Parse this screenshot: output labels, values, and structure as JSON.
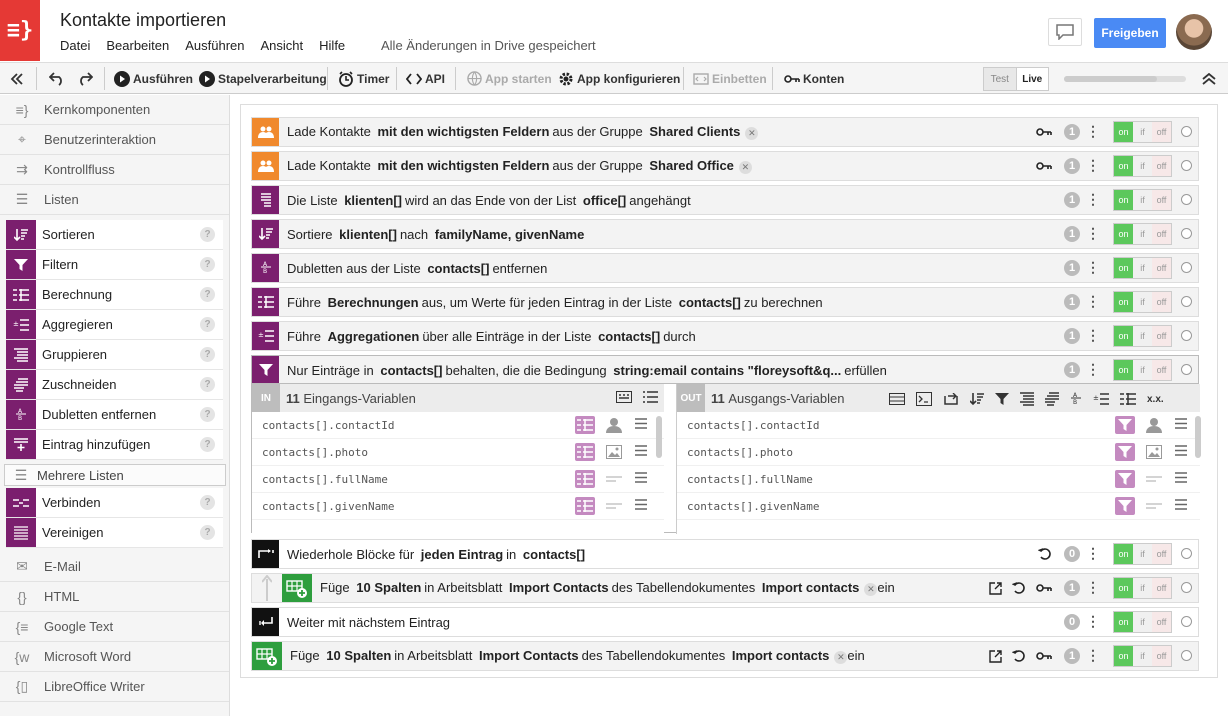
{
  "app": {
    "logo": "≡}",
    "title": "Kontakte importieren",
    "menu": [
      "Datei",
      "Bearbeiten",
      "Ausführen",
      "Ansicht",
      "Hilfe"
    ],
    "saved": "Alle Änderungen in Drive gespeichert",
    "share": "Freigeben"
  },
  "toolbar": {
    "run": "Ausführen",
    "batch": "Stapelverarbeitung",
    "timer": "Timer",
    "api": "API",
    "app_start": "App starten",
    "app_config": "App konfigurieren",
    "embed": "Einbetten",
    "accounts": "Konten",
    "test": "Test",
    "live": "Live"
  },
  "sidebar": {
    "categories_top": [
      "Kernkomponenten",
      "Benutzerinteraktion",
      "Kontrollfluss",
      "Listen"
    ],
    "list_items": [
      "Sortieren",
      "Filtern",
      "Berechnung",
      "Aggregieren",
      "Gruppieren",
      "Zuschneiden",
      "Dubletten entfernen",
      "Eintrag hinzufügen"
    ],
    "multi_header": "Mehrere Listen",
    "multi_items": [
      "Verbinden",
      "Vereinigen"
    ],
    "categories_bottom": [
      "E-Mail",
      "HTML",
      "Google Text",
      "Microsoft Word",
      "LibreOffice Writer"
    ],
    "help": "?"
  },
  "flow": {
    "on": "on",
    "if": "if",
    "off": "off",
    "rows": [
      {
        "parts": [
          "Lade Kontakte",
          "mit den wichtigsten Feldern",
          "aus der Gruppe",
          "Shared Clients"
        ],
        "count": "1",
        "color": "#f0892d"
      },
      {
        "parts": [
          "Lade Kontakte",
          "mit den wichtigsten Feldern",
          "aus der Gruppe",
          "Shared Office"
        ],
        "count": "1",
        "color": "#f0892d"
      },
      {
        "parts": [
          "Die Liste",
          "klienten[]",
          "wird an das Ende von der List",
          "office[]",
          "angehängt"
        ],
        "count": "1",
        "color": "#7b1f6e"
      },
      {
        "parts": [
          "Sortiere",
          "klienten[]",
          "nach",
          "familyName, givenName"
        ],
        "count": "1",
        "color": "#7b1f6e"
      },
      {
        "parts": [
          "Dubletten aus der Liste",
          "contacts[]",
          "entfernen"
        ],
        "count": "1",
        "color": "#7b1f6e"
      },
      {
        "parts": [
          "Führe",
          "Berechnungen",
          "aus, um Werte für jeden Eintrag in der Liste",
          "contacts[]",
          "zu berechnen"
        ],
        "count": "1",
        "color": "#7b1f6e"
      },
      {
        "parts": [
          "Führe",
          "Aggregationen",
          "über alle Einträge in der Liste",
          "contacts[]",
          "durch"
        ],
        "count": "1",
        "color": "#7b1f6e"
      },
      {
        "parts": [
          "Nur Einträge in",
          "contacts[]",
          "behalten, die die Bedingung",
          "string:email contains \"floreysoft&q...",
          "erfüllen"
        ],
        "count": "1",
        "color": "#7b1f6e"
      },
      {
        "parts": [
          "Wiederhole Blöcke für",
          "jeden Eintrag",
          "in",
          "contacts[]"
        ],
        "count": "0",
        "color": "#111111"
      },
      {
        "parts": [
          "Füge",
          "10 Spalten",
          "in Arbeitsblatt",
          "Import Contacts",
          "des Tabellendokumentes",
          "Import contacts",
          "ein"
        ],
        "count": "1",
        "color": "#2e9e3e"
      },
      {
        "parts": [
          "Weiter mit nächstem Eintrag"
        ],
        "count": "0",
        "color": "#111111"
      },
      {
        "parts": [
          "Füge",
          "10 Spalten",
          "in Arbeitsblatt",
          "Import Contacts",
          "des Tabellendokumentes",
          "Import contacts",
          "ein"
        ],
        "count": "1",
        "color": "#2e9e3e"
      }
    ],
    "in_panel": {
      "tag": "IN",
      "count": "11",
      "label": "Eingangs-Variablen",
      "vars": [
        "contacts[].contactId",
        "contacts[].photo",
        "contacts[].fullName",
        "contacts[].givenName"
      ]
    },
    "out_panel": {
      "tag": "OUT",
      "count": "11",
      "label": "Ausgangs-Variablen",
      "vars": [
        "contacts[].contactId",
        "contacts[].photo",
        "contacts[].fullName",
        "contacts[].givenName"
      ],
      "more": "x.x."
    }
  }
}
